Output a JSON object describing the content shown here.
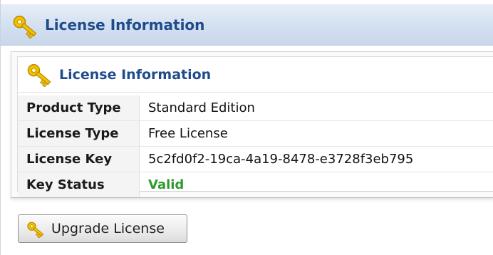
{
  "header": {
    "title": "License Information",
    "icon": "key-icon"
  },
  "panel": {
    "title": "License Information",
    "icon": "key-icon",
    "rows": [
      {
        "label": "Product Type",
        "value": "Standard Edition"
      },
      {
        "label": "License Type",
        "value": "Free License"
      },
      {
        "label": "License Key",
        "value": "5c2fd0f2-19ca-4a19-8478-e3728f3eb795"
      },
      {
        "label": "Key Status",
        "value": "Valid"
      }
    ]
  },
  "actions": {
    "upgrade_label": "Upgrade License",
    "upgrade_icon": "key-icon"
  },
  "colors": {
    "title": "#1f4b8c",
    "status_valid": "#2f9a2f",
    "key_gold": "#e8b400"
  }
}
